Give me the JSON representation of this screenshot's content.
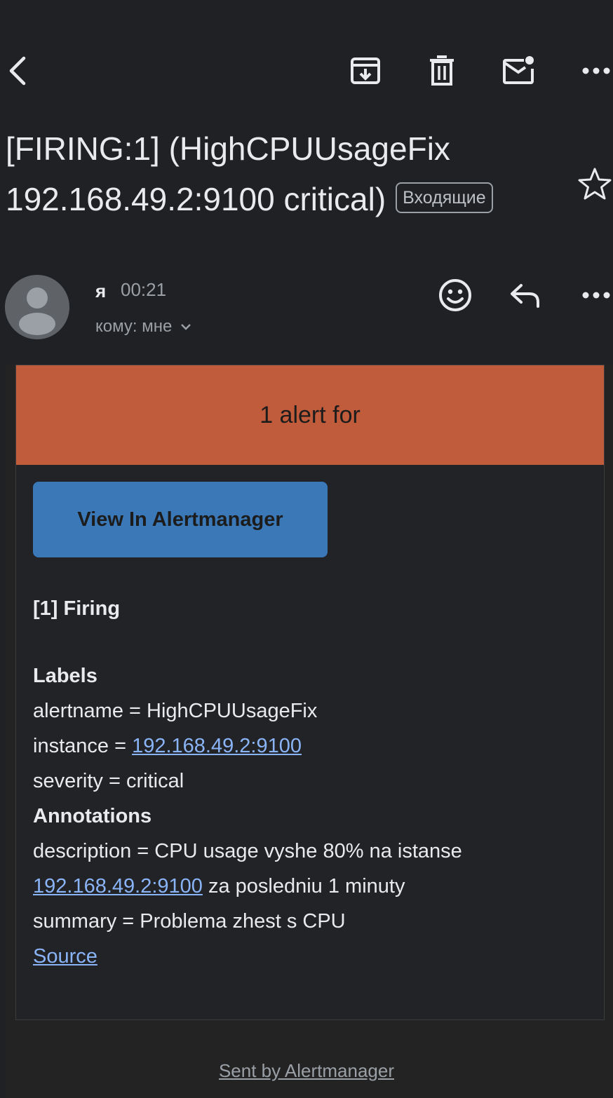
{
  "colors": {
    "background": "#202124",
    "alert_header": "#c05b3b",
    "view_button": "#3a78b8",
    "link": "#8ab4f8"
  },
  "toolbar": {
    "icons": [
      "back-arrow-icon",
      "archive-icon",
      "trash-icon",
      "mark-unread-icon",
      "more-vert-icon"
    ]
  },
  "email": {
    "subject": "[FIRING:1]  (HighCPUUsageFix 192.168.49.2:9100 critical)",
    "label_chip": "Входящие",
    "sender": "я",
    "time": "00:21",
    "recipient": "кому: мне"
  },
  "alert": {
    "header": "1 alert for",
    "view_button": "View In Alertmanager",
    "firing": "[1] Firing",
    "labels_heading": "Labels",
    "alertname": "alertname = HighCPUUsageFix",
    "instance_prefix": "instance = ",
    "instance_link": "192.168.49.2:9100",
    "severity": "severity = critical",
    "annotations_heading": "Annotations",
    "description": "description = CPU usage vyshe 80% na istanse",
    "description_link": "192.168.49.2:9100",
    "description_suffix": " za posledniu 1 minuty",
    "summary": "summary = Problema zhest s CPU",
    "source_link": "Source"
  },
  "footer": {
    "text": "Sent by Alertmanager"
  }
}
